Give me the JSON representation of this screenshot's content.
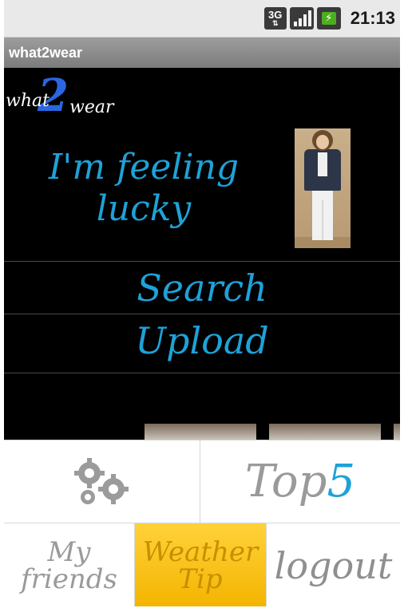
{
  "status_bar": {
    "network": "3G",
    "time": "21:13"
  },
  "app": {
    "title": "what2wear"
  },
  "logo": {
    "what": "what",
    "two": "2",
    "wear": "wear"
  },
  "home": {
    "feeling_lucky": "I'm feeling lucky",
    "search": "Search",
    "upload": "Upload"
  },
  "bottom_menu": {
    "settings_icon": "gears-icon",
    "top5_word": "Top",
    "top5_digit": "5",
    "friends": "My friends",
    "weather": "Weather Tip",
    "logout": "logout"
  },
  "colors": {
    "accent": "#1ea2d8",
    "weather_bg": "#f4b400",
    "background": "#000000"
  }
}
